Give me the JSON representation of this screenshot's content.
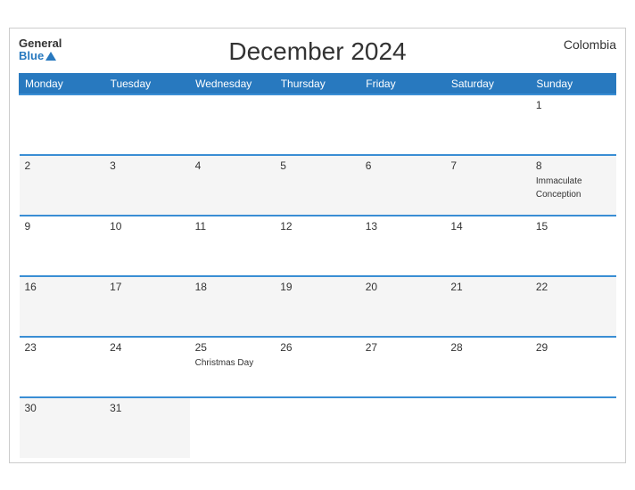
{
  "header": {
    "title": "December 2024",
    "country": "Colombia",
    "logo_general": "General",
    "logo_blue": "Blue"
  },
  "weekdays": [
    "Monday",
    "Tuesday",
    "Wednesday",
    "Thursday",
    "Friday",
    "Saturday",
    "Sunday"
  ],
  "rows": [
    [
      {
        "day": "",
        "event": ""
      },
      {
        "day": "",
        "event": ""
      },
      {
        "day": "",
        "event": ""
      },
      {
        "day": "",
        "event": ""
      },
      {
        "day": "",
        "event": ""
      },
      {
        "day": "",
        "event": ""
      },
      {
        "day": "1",
        "event": ""
      }
    ],
    [
      {
        "day": "2",
        "event": ""
      },
      {
        "day": "3",
        "event": ""
      },
      {
        "day": "4",
        "event": ""
      },
      {
        "day": "5",
        "event": ""
      },
      {
        "day": "6",
        "event": ""
      },
      {
        "day": "7",
        "event": ""
      },
      {
        "day": "8",
        "event": "Immaculate Conception"
      }
    ],
    [
      {
        "day": "9",
        "event": ""
      },
      {
        "day": "10",
        "event": ""
      },
      {
        "day": "11",
        "event": ""
      },
      {
        "day": "12",
        "event": ""
      },
      {
        "day": "13",
        "event": ""
      },
      {
        "day": "14",
        "event": ""
      },
      {
        "day": "15",
        "event": ""
      }
    ],
    [
      {
        "day": "16",
        "event": ""
      },
      {
        "day": "17",
        "event": ""
      },
      {
        "day": "18",
        "event": ""
      },
      {
        "day": "19",
        "event": ""
      },
      {
        "day": "20",
        "event": ""
      },
      {
        "day": "21",
        "event": ""
      },
      {
        "day": "22",
        "event": ""
      }
    ],
    [
      {
        "day": "23",
        "event": ""
      },
      {
        "day": "24",
        "event": ""
      },
      {
        "day": "25",
        "event": "Christmas Day"
      },
      {
        "day": "26",
        "event": ""
      },
      {
        "day": "27",
        "event": ""
      },
      {
        "day": "28",
        "event": ""
      },
      {
        "day": "29",
        "event": ""
      }
    ],
    [
      {
        "day": "30",
        "event": ""
      },
      {
        "day": "31",
        "event": ""
      },
      {
        "day": "",
        "event": ""
      },
      {
        "day": "",
        "event": ""
      },
      {
        "day": "",
        "event": ""
      },
      {
        "day": "",
        "event": ""
      },
      {
        "day": "",
        "event": ""
      }
    ]
  ]
}
